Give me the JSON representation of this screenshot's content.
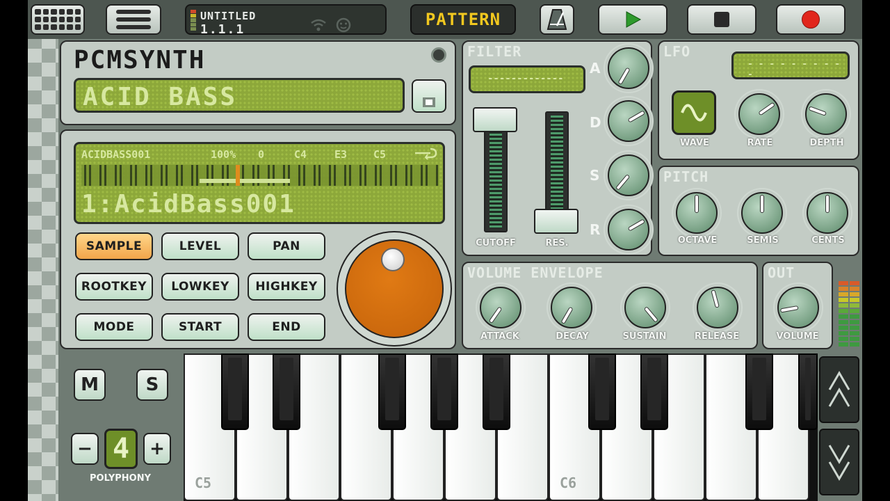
{
  "topbar": {
    "song_title": "UNTITLED",
    "position": "1.1.1",
    "pattern_label": "PATTERN",
    "wifi_icon": "wifi-icon",
    "face_icon": "face-icon"
  },
  "synth": {
    "name": "PCMSYNTH",
    "preset_name": "ACID BASS"
  },
  "sample_display": {
    "sample_name": "ACIDBASS001",
    "level": "100%",
    "pan": "0",
    "rootkey": "C4",
    "lowkey": "E3",
    "highkey": "C5",
    "loop_icon": "loop-icon",
    "big_text": "1:AcidBass001"
  },
  "param_buttons": [
    "SAMPLE",
    "LEVEL",
    "PAN",
    "ROOTKEY",
    "LOWKEY",
    "HIGHKEY",
    "MODE",
    "START",
    "END"
  ],
  "filter": {
    "title": "FILTER",
    "lcd": "-------------",
    "cutoff_label": "CUTOFF",
    "res_label": "RES.",
    "adsr": [
      "A",
      "D",
      "S",
      "R"
    ]
  },
  "lfo": {
    "title": "LFO",
    "lcd": "- - - - - - - - - -",
    "wave_label": "WAVE",
    "rate_label": "RATE",
    "depth_label": "DEPTH"
  },
  "pitch": {
    "title": "PITCH",
    "labels": [
      "OCTAVE",
      "SEMIS",
      "CENTS"
    ]
  },
  "volume_envelope": {
    "title": "VOLUME ENVELOPE",
    "labels": [
      "ATTACK",
      "DECAY",
      "SUSTAIN",
      "RELEASE"
    ]
  },
  "out": {
    "title": "OUT",
    "label": "VOLUME"
  },
  "left_controls": {
    "mute": "M",
    "solo": "S",
    "minus": "−",
    "plus": "+",
    "polyphony_value": "4",
    "polyphony_label": "POLYPHONY"
  },
  "keyboard": {
    "labels": [
      "C5",
      "C6"
    ]
  },
  "colors": {
    "lcd_green": "#8da83a",
    "active_orange": "#f2a54a",
    "xy_pad": "#d46f0c",
    "record_red": "#e1261c",
    "play_green": "#2e9a2c",
    "pattern_yellow": "#f2c81f"
  }
}
